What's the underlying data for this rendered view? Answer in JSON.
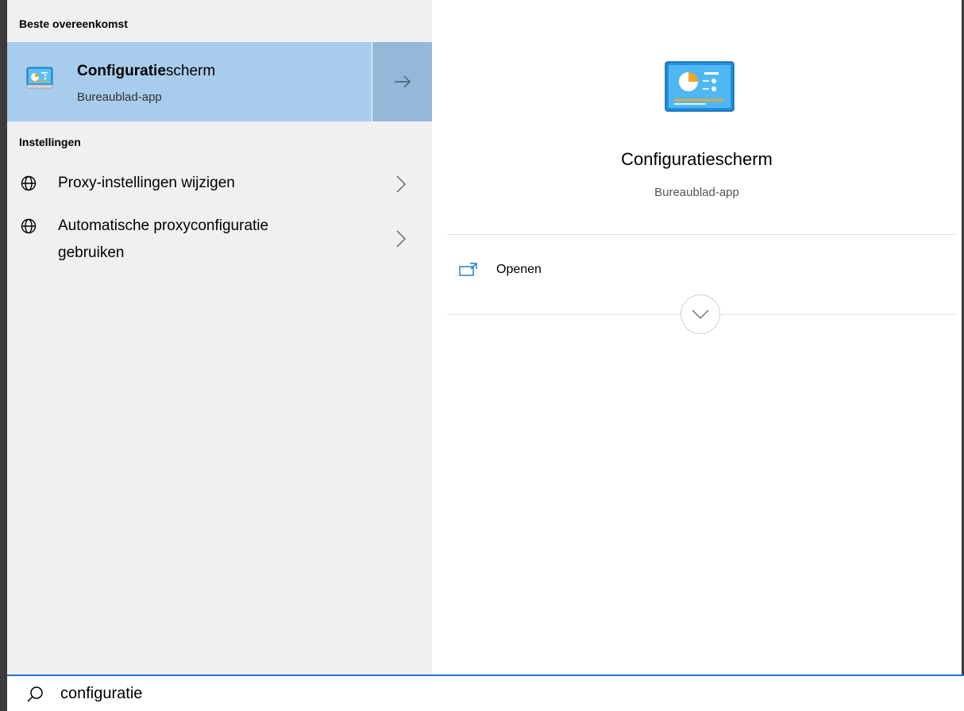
{
  "left_panel": {
    "best_match_header": "Beste overeenkomst",
    "best_match": {
      "title_bold": "Configuratie",
      "title_rest": "scherm",
      "subtitle": "Bureaublad-app",
      "arrow_icon": "arrow-right-icon"
    },
    "settings_header": "Instellingen",
    "settings_items": [
      {
        "icon": "globe-icon",
        "label_line1": "Proxy-instellingen wijzigen",
        "label_line2": ""
      },
      {
        "icon": "globe-icon",
        "label_line1": "Automatische proxyconfiguratie",
        "label_line2": "gebruiken"
      }
    ]
  },
  "detail_panel": {
    "icon": "control-panel-icon",
    "title": "Configuratiescherm",
    "subtitle": "Bureaublad-app",
    "actions": [
      {
        "icon": "open-window-icon",
        "label": "Openen"
      }
    ],
    "expand_icon": "chevron-down-icon"
  },
  "search": {
    "icon": "search-icon",
    "value": "configuratie"
  },
  "colors": {
    "selected_bg": "#a8cceb",
    "arrow_bg": "#94b8d7",
    "left_panel_bg": "#f0f0f0",
    "accent": "#1d75d0"
  }
}
